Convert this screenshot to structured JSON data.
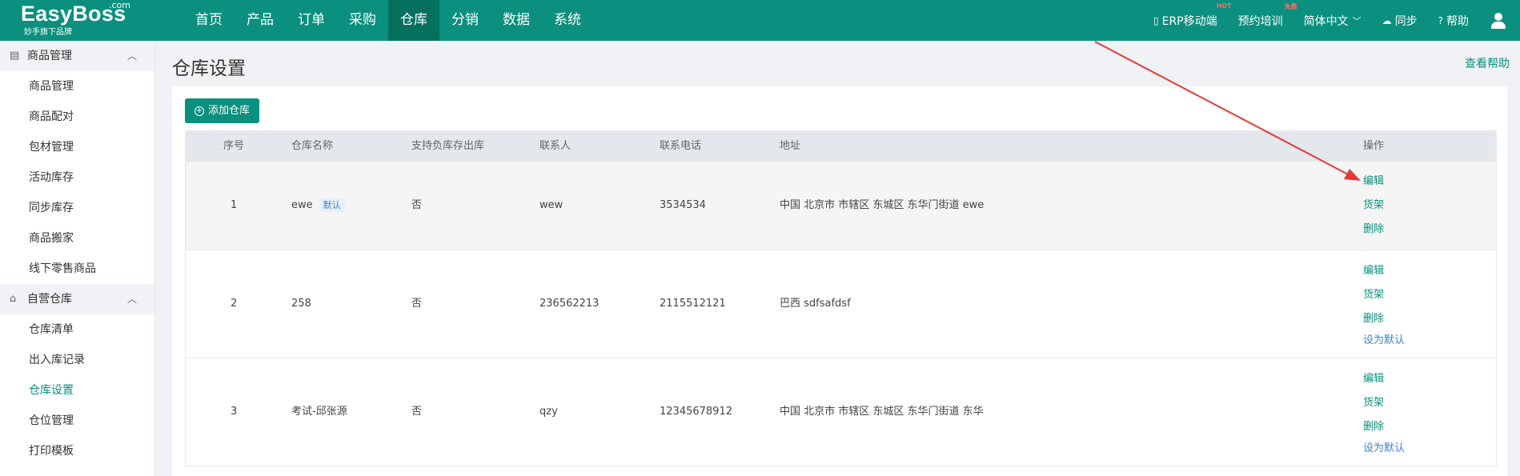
{
  "brand": {
    "name": "EasyBoss",
    "com": ".com",
    "subtitle": "妙手旗下品牌"
  },
  "nav": [
    "首页",
    "产品",
    "订单",
    "采购",
    "仓库",
    "分销",
    "数据",
    "系统"
  ],
  "nav_active": "仓库",
  "top_right": {
    "erp": "ERP移动端",
    "erp_badge": "HOT",
    "training": "预约培训",
    "training_badge": "免费",
    "language": "简体中文",
    "sync": "同步",
    "help": "帮助"
  },
  "sidebar": {
    "groups": [
      {
        "title": "商品管理",
        "items": [
          "商品管理",
          "商品配对",
          "包材管理",
          "活动库存",
          "同步库存",
          "商品搬家",
          "线下零售商品"
        ]
      },
      {
        "title": "自营仓库",
        "items": [
          "仓库清单",
          "出入库记录",
          "仓库设置",
          "仓位管理",
          "打印模板"
        ]
      }
    ],
    "active_item": "仓库设置"
  },
  "page": {
    "title": "仓库设置",
    "help_link": "查看帮助",
    "add_button": "添加仓库"
  },
  "table": {
    "columns": [
      "序号",
      "仓库名称",
      "支持负库存出库",
      "联系人",
      "联系电话",
      "地址",
      "操作"
    ],
    "default_tag": "默认",
    "rows": [
      {
        "no": "1",
        "name": "ewe",
        "is_default": true,
        "negative": "否",
        "contact": "wew",
        "phone": "3534534",
        "address": "中国 北京市 市辖区 东城区 东华门街道 ewe",
        "ops": [
          "编辑",
          "货架",
          "删除"
        ]
      },
      {
        "no": "2",
        "name": "258",
        "is_default": false,
        "negative": "否",
        "contact": "236562213",
        "phone": "2115512121",
        "address": "巴西 sdfsafdsf",
        "ops": [
          "编辑",
          "货架",
          "删除",
          "设为默认"
        ]
      },
      {
        "no": "3",
        "name": "考试-邱张源",
        "is_default": false,
        "negative": "否",
        "contact": "qzy",
        "phone": "12345678912",
        "address": "中国 北京市 市辖区 东城区 东华门街道 东华",
        "ops": [
          "编辑",
          "货架",
          "删除",
          "设为默认"
        ]
      }
    ]
  },
  "colors": {
    "brand": "#0b8f7e",
    "nav_active": "#06705f",
    "link_blue": "#3b7fd1",
    "annotation_arrow": "#e53935"
  }
}
